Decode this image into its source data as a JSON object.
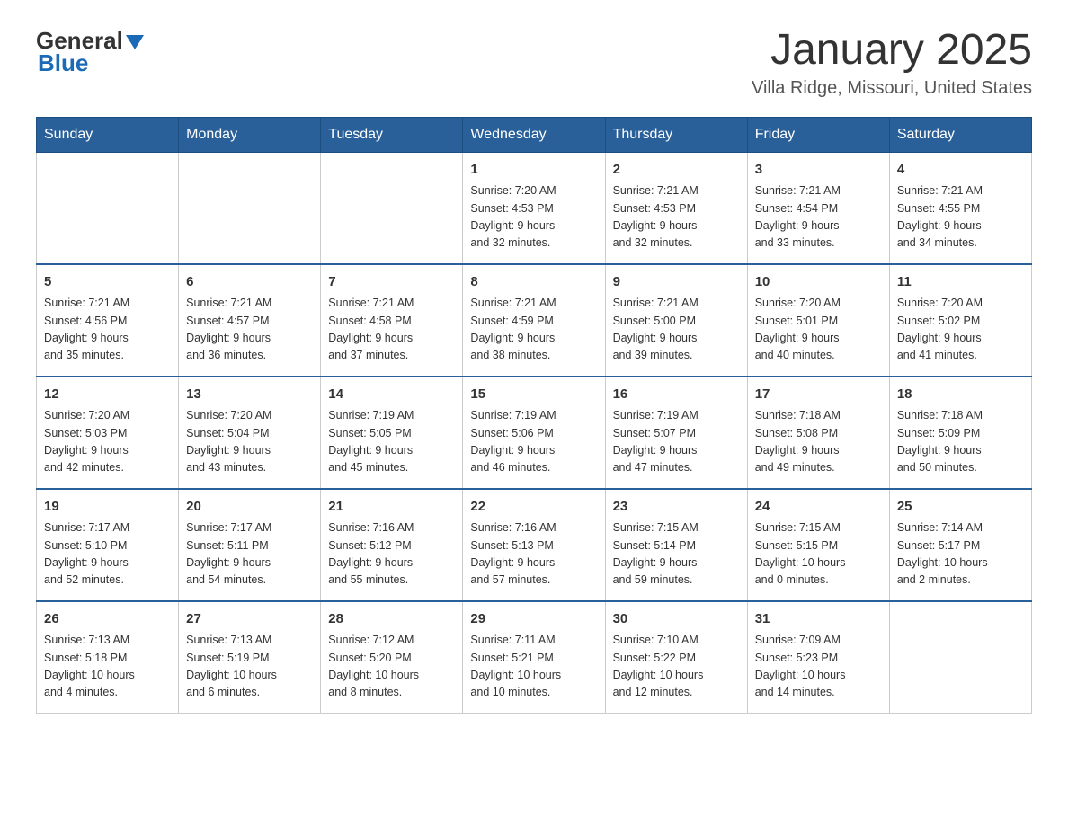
{
  "header": {
    "logo": {
      "general": "General",
      "blue": "Blue"
    },
    "title": "January 2025",
    "subtitle": "Villa Ridge, Missouri, United States"
  },
  "calendar": {
    "days_of_week": [
      "Sunday",
      "Monday",
      "Tuesday",
      "Wednesday",
      "Thursday",
      "Friday",
      "Saturday"
    ],
    "weeks": [
      {
        "days": [
          {
            "number": "",
            "info": ""
          },
          {
            "number": "",
            "info": ""
          },
          {
            "number": "",
            "info": ""
          },
          {
            "number": "1",
            "info": "Sunrise: 7:20 AM\nSunset: 4:53 PM\nDaylight: 9 hours\nand 32 minutes."
          },
          {
            "number": "2",
            "info": "Sunrise: 7:21 AM\nSunset: 4:53 PM\nDaylight: 9 hours\nand 32 minutes."
          },
          {
            "number": "3",
            "info": "Sunrise: 7:21 AM\nSunset: 4:54 PM\nDaylight: 9 hours\nand 33 minutes."
          },
          {
            "number": "4",
            "info": "Sunrise: 7:21 AM\nSunset: 4:55 PM\nDaylight: 9 hours\nand 34 minutes."
          }
        ]
      },
      {
        "days": [
          {
            "number": "5",
            "info": "Sunrise: 7:21 AM\nSunset: 4:56 PM\nDaylight: 9 hours\nand 35 minutes."
          },
          {
            "number": "6",
            "info": "Sunrise: 7:21 AM\nSunset: 4:57 PM\nDaylight: 9 hours\nand 36 minutes."
          },
          {
            "number": "7",
            "info": "Sunrise: 7:21 AM\nSunset: 4:58 PM\nDaylight: 9 hours\nand 37 minutes."
          },
          {
            "number": "8",
            "info": "Sunrise: 7:21 AM\nSunset: 4:59 PM\nDaylight: 9 hours\nand 38 minutes."
          },
          {
            "number": "9",
            "info": "Sunrise: 7:21 AM\nSunset: 5:00 PM\nDaylight: 9 hours\nand 39 minutes."
          },
          {
            "number": "10",
            "info": "Sunrise: 7:20 AM\nSunset: 5:01 PM\nDaylight: 9 hours\nand 40 minutes."
          },
          {
            "number": "11",
            "info": "Sunrise: 7:20 AM\nSunset: 5:02 PM\nDaylight: 9 hours\nand 41 minutes."
          }
        ]
      },
      {
        "days": [
          {
            "number": "12",
            "info": "Sunrise: 7:20 AM\nSunset: 5:03 PM\nDaylight: 9 hours\nand 42 minutes."
          },
          {
            "number": "13",
            "info": "Sunrise: 7:20 AM\nSunset: 5:04 PM\nDaylight: 9 hours\nand 43 minutes."
          },
          {
            "number": "14",
            "info": "Sunrise: 7:19 AM\nSunset: 5:05 PM\nDaylight: 9 hours\nand 45 minutes."
          },
          {
            "number": "15",
            "info": "Sunrise: 7:19 AM\nSunset: 5:06 PM\nDaylight: 9 hours\nand 46 minutes."
          },
          {
            "number": "16",
            "info": "Sunrise: 7:19 AM\nSunset: 5:07 PM\nDaylight: 9 hours\nand 47 minutes."
          },
          {
            "number": "17",
            "info": "Sunrise: 7:18 AM\nSunset: 5:08 PM\nDaylight: 9 hours\nand 49 minutes."
          },
          {
            "number": "18",
            "info": "Sunrise: 7:18 AM\nSunset: 5:09 PM\nDaylight: 9 hours\nand 50 minutes."
          }
        ]
      },
      {
        "days": [
          {
            "number": "19",
            "info": "Sunrise: 7:17 AM\nSunset: 5:10 PM\nDaylight: 9 hours\nand 52 minutes."
          },
          {
            "number": "20",
            "info": "Sunrise: 7:17 AM\nSunset: 5:11 PM\nDaylight: 9 hours\nand 54 minutes."
          },
          {
            "number": "21",
            "info": "Sunrise: 7:16 AM\nSunset: 5:12 PM\nDaylight: 9 hours\nand 55 minutes."
          },
          {
            "number": "22",
            "info": "Sunrise: 7:16 AM\nSunset: 5:13 PM\nDaylight: 9 hours\nand 57 minutes."
          },
          {
            "number": "23",
            "info": "Sunrise: 7:15 AM\nSunset: 5:14 PM\nDaylight: 9 hours\nand 59 minutes."
          },
          {
            "number": "24",
            "info": "Sunrise: 7:15 AM\nSunset: 5:15 PM\nDaylight: 10 hours\nand 0 minutes."
          },
          {
            "number": "25",
            "info": "Sunrise: 7:14 AM\nSunset: 5:17 PM\nDaylight: 10 hours\nand 2 minutes."
          }
        ]
      },
      {
        "days": [
          {
            "number": "26",
            "info": "Sunrise: 7:13 AM\nSunset: 5:18 PM\nDaylight: 10 hours\nand 4 minutes."
          },
          {
            "number": "27",
            "info": "Sunrise: 7:13 AM\nSunset: 5:19 PM\nDaylight: 10 hours\nand 6 minutes."
          },
          {
            "number": "28",
            "info": "Sunrise: 7:12 AM\nSunset: 5:20 PM\nDaylight: 10 hours\nand 8 minutes."
          },
          {
            "number": "29",
            "info": "Sunrise: 7:11 AM\nSunset: 5:21 PM\nDaylight: 10 hours\nand 10 minutes."
          },
          {
            "number": "30",
            "info": "Sunrise: 7:10 AM\nSunset: 5:22 PM\nDaylight: 10 hours\nand 12 minutes."
          },
          {
            "number": "31",
            "info": "Sunrise: 7:09 AM\nSunset: 5:23 PM\nDaylight: 10 hours\nand 14 minutes."
          },
          {
            "number": "",
            "info": ""
          }
        ]
      }
    ]
  }
}
